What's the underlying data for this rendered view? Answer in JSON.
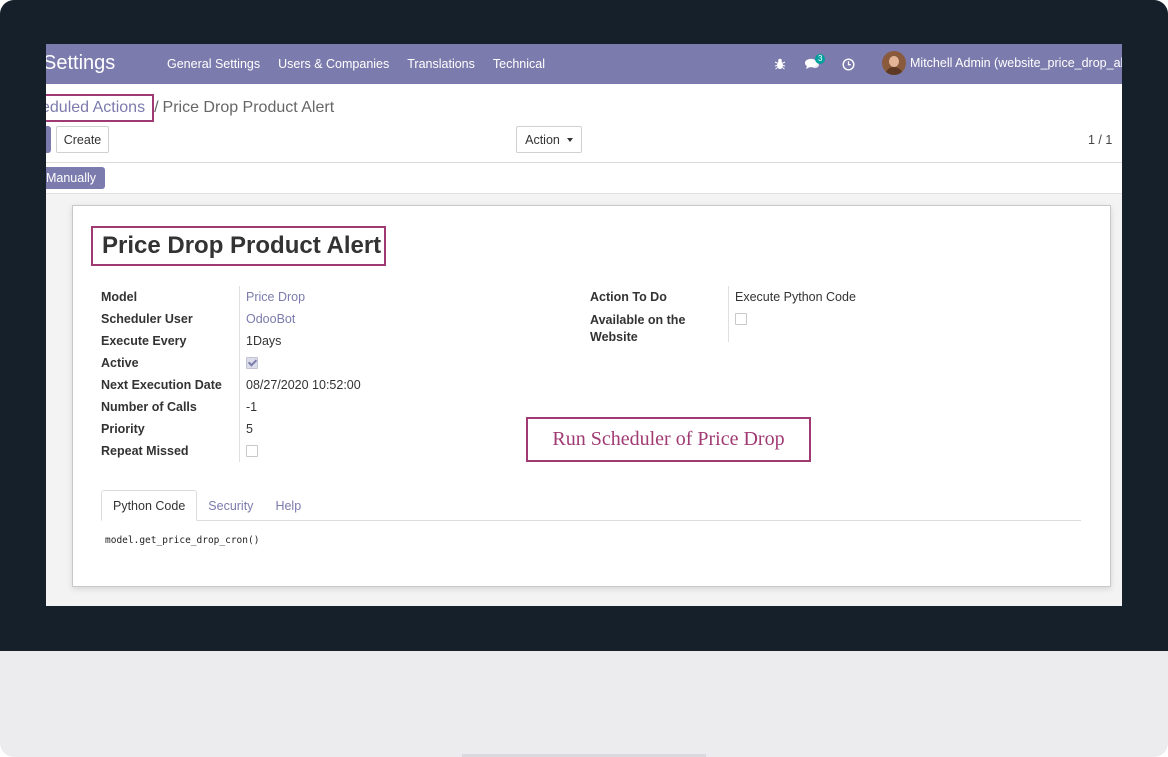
{
  "navbar": {
    "app_title": "Settings",
    "menu": [
      "General Settings",
      "Users & Companies",
      "Translations",
      "Technical"
    ],
    "messages_badge": "3",
    "user_name": "Mitchell Admin (website_price_drop_alert)"
  },
  "breadcrumb": {
    "parent": "eduled Actions",
    "separator": "/",
    "current": "Price Drop Product Alert"
  },
  "toolbar": {
    "create_label": "Create",
    "action_label": "Action",
    "pager": "1 / 1",
    "run_label": "Manually"
  },
  "record": {
    "title": "Price Drop Product Alert",
    "left_fields": [
      {
        "label": "Model",
        "value": "Price Drop"
      },
      {
        "label": "Scheduler User",
        "value": "OdooBot"
      },
      {
        "label": "Execute Every",
        "value": "1Days"
      },
      {
        "label": "Active",
        "checked": true
      },
      {
        "label": "Next Execution Date",
        "value": "08/27/2020 10:52:00"
      },
      {
        "label": "Number of Calls",
        "value": "-1"
      },
      {
        "label": "Priority",
        "value": "5"
      },
      {
        "label": "Repeat Missed",
        "checked": false
      }
    ],
    "right_fields": [
      {
        "label": "Action To Do",
        "value": "Execute Python Code"
      },
      {
        "label_line1": "Available on the",
        "label_line2": "Website",
        "checked": false
      }
    ]
  },
  "annotation": "Run Scheduler of Price Drop",
  "tabs": [
    "Python Code",
    "Security",
    "Help"
  ],
  "code": "model.get_price_drop_cron()",
  "colors": {
    "brand": "#7c7bad",
    "highlight_border": "#a03a73",
    "frame": "#15202b"
  }
}
